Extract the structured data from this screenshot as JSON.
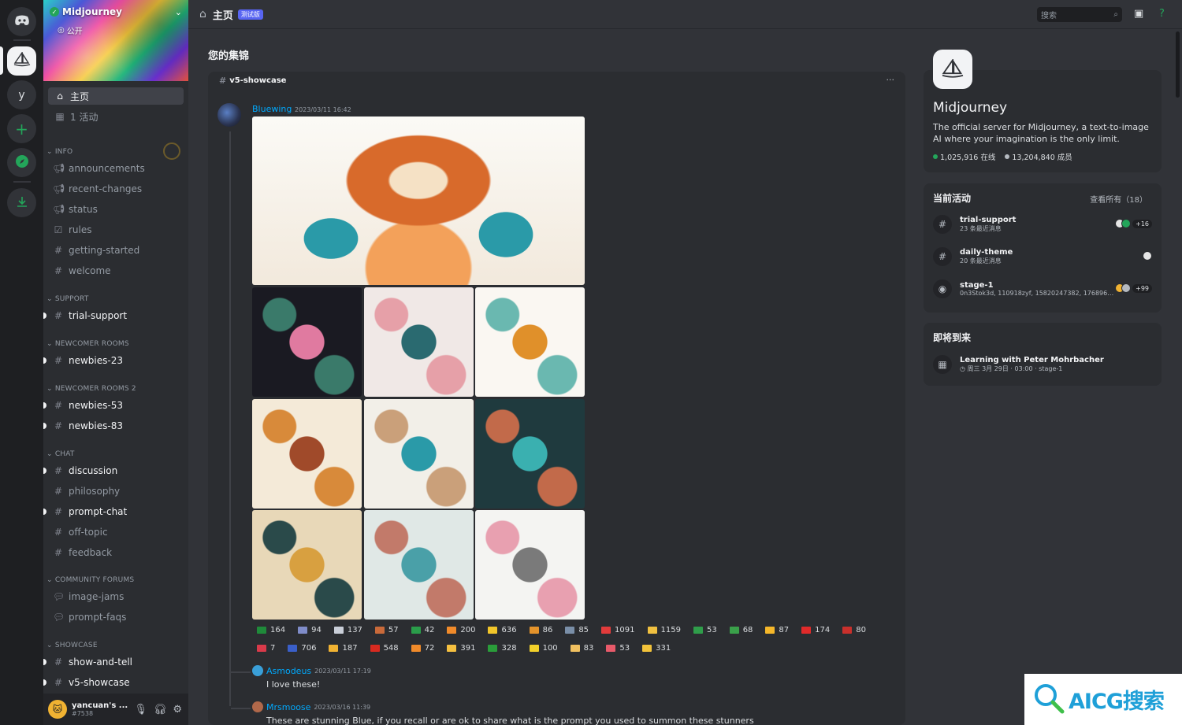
{
  "rail": {
    "letter": "y"
  },
  "server": {
    "name": "Midjourney",
    "visibility": "公开"
  },
  "nav": [
    {
      "label": "主页",
      "icon": "home-icon",
      "selected": true
    },
    {
      "label": "1 活动",
      "icon": "calendar-icon",
      "selected": false
    }
  ],
  "categories": [
    {
      "label": "INFO",
      "channels": [
        {
          "label": "announcements",
          "icon": "megaphone-icon",
          "unread": false
        },
        {
          "label": "recent-changes",
          "icon": "megaphone-icon",
          "unread": false
        },
        {
          "label": "status",
          "icon": "megaphone-icon",
          "unread": false
        },
        {
          "label": "rules",
          "icon": "checkbox-icon",
          "unread": false
        },
        {
          "label": "getting-started",
          "icon": "hash-icon",
          "unread": false
        },
        {
          "label": "welcome",
          "icon": "hash-icon",
          "unread": false
        }
      ]
    },
    {
      "label": "SUPPORT",
      "channels": [
        {
          "label": "trial-support",
          "icon": "hash-icon",
          "unread": true
        }
      ]
    },
    {
      "label": "NEWCOMER ROOMS",
      "channels": [
        {
          "label": "newbies-23",
          "icon": "thread-hash-icon",
          "unread": true
        }
      ]
    },
    {
      "label": "NEWCOMER ROOMS 2",
      "channels": [
        {
          "label": "newbies-53",
          "icon": "thread-hash-icon",
          "unread": true
        },
        {
          "label": "newbies-83",
          "icon": "thread-hash-icon",
          "unread": true
        }
      ]
    },
    {
      "label": "CHAT",
      "channels": [
        {
          "label": "discussion",
          "icon": "hash-icon",
          "unread": true
        },
        {
          "label": "philosophy",
          "icon": "hash-icon",
          "unread": false
        },
        {
          "label": "prompt-chat",
          "icon": "hash-icon",
          "unread": true
        },
        {
          "label": "off-topic",
          "icon": "hash-icon",
          "unread": false
        },
        {
          "label": "feedback",
          "icon": "hash-icon",
          "unread": false
        }
      ]
    },
    {
      "label": "COMMUNITY FORUMS",
      "channels": [
        {
          "label": "image-jams",
          "icon": "forum-icon",
          "unread": false
        },
        {
          "label": "prompt-faqs",
          "icon": "forum-icon",
          "unread": false
        }
      ]
    },
    {
      "label": "SHOWCASE",
      "channels": [
        {
          "label": "show-and-tell",
          "icon": "hash-icon",
          "unread": true
        },
        {
          "label": "v5-showcase",
          "icon": "hash-icon",
          "unread": true
        }
      ]
    }
  ],
  "user": {
    "name": "yancuan's ...",
    "tag": "#7538"
  },
  "topbar": {
    "title": "主页",
    "badge": "测试版",
    "search_placeholder": "搜索"
  },
  "highlights": {
    "title": "您的集锦",
    "channel": "v5-showcase",
    "post": {
      "author": "Bluewing",
      "time": "2023/03/11 16:42"
    },
    "reactions": [
      {
        "color": "#1f8a3a",
        "count": "164"
      },
      {
        "color": "#7f8cc9",
        "count": "94"
      },
      {
        "color": "#c9ced8",
        "count": "137"
      },
      {
        "color": "#c96a3a",
        "count": "57"
      },
      {
        "color": "#2a9d4a",
        "count": "42"
      },
      {
        "color": "#f08a2a",
        "count": "200"
      },
      {
        "color": "#f2c62a",
        "count": "636"
      },
      {
        "color": "#e4932b",
        "count": "86"
      },
      {
        "color": "#7a8fa8",
        "count": "85"
      },
      {
        "color": "#e23b3b",
        "count": "1091"
      },
      {
        "color": "#f0c040",
        "count": "1159"
      },
      {
        "color": "#2f9d4a",
        "count": "53"
      },
      {
        "color": "#3aa04a",
        "count": "68"
      },
      {
        "color": "#f5b72a",
        "count": "87"
      },
      {
        "color": "#e02a2a",
        "count": "174"
      },
      {
        "color": "#c9302c",
        "count": "80"
      },
      {
        "color": "#d93a4a",
        "count": "7"
      },
      {
        "color": "#3a5fc9",
        "count": "706"
      },
      {
        "color": "#f0b232",
        "count": "187"
      },
      {
        "color": "#d82a20",
        "count": "548"
      },
      {
        "color": "#f08a2a",
        "count": "72"
      },
      {
        "color": "#f5c040",
        "count": "391"
      },
      {
        "color": "#2a9d3a",
        "count": "328"
      },
      {
        "color": "#f2d02a",
        "count": "100"
      },
      {
        "color": "#f0c060",
        "count": "83"
      },
      {
        "color": "#e85a6a",
        "count": "53"
      },
      {
        "color": "#f2c23a",
        "count": "331"
      }
    ],
    "replies": [
      {
        "author": "Asmodeus",
        "time": "2023/03/11 17:19",
        "text": "I love these!",
        "avatar": "#3a9fd8"
      },
      {
        "author": "Mrsmoose",
        "time": "2023/03/16 11:39",
        "text": "These are stunning Blue, if you recall or are ok to share what is the prompt you used to summon these stunners",
        "avatar": "#b0684a"
      }
    ]
  },
  "about": {
    "name": "Midjourney",
    "description": "The official server for Midjourney, a text-to-image AI where your imagination is the only limit.",
    "online": "1,025,916 在线",
    "members": "13,204,840 成员",
    "online_color": "#23a55a",
    "members_color": "#b5bac1"
  },
  "activity": {
    "title": "当前活动",
    "view_all": "查看所有（18）",
    "items": [
      {
        "name": "trial-support",
        "sub": "23 条最近消息",
        "icon": "hash-icon",
        "extra": "+16"
      },
      {
        "name": "daily-theme",
        "sub": "20 条最近消息",
        "icon": "hash-icon",
        "extra": ""
      },
      {
        "name": "stage-1",
        "sub": "0n3Stok3d, 110918zyf, 15820247382, 17689658406...",
        "icon": "stage-icon",
        "extra": "+99"
      }
    ]
  },
  "upcoming": {
    "title": "即将到来",
    "event": {
      "name": "Learning with Peter Mohrbacher",
      "time": "周三 3月 29日 · 03:00 · ",
      "location": "stage-1"
    }
  },
  "watermark": {
    "text": "AICG搜索"
  }
}
